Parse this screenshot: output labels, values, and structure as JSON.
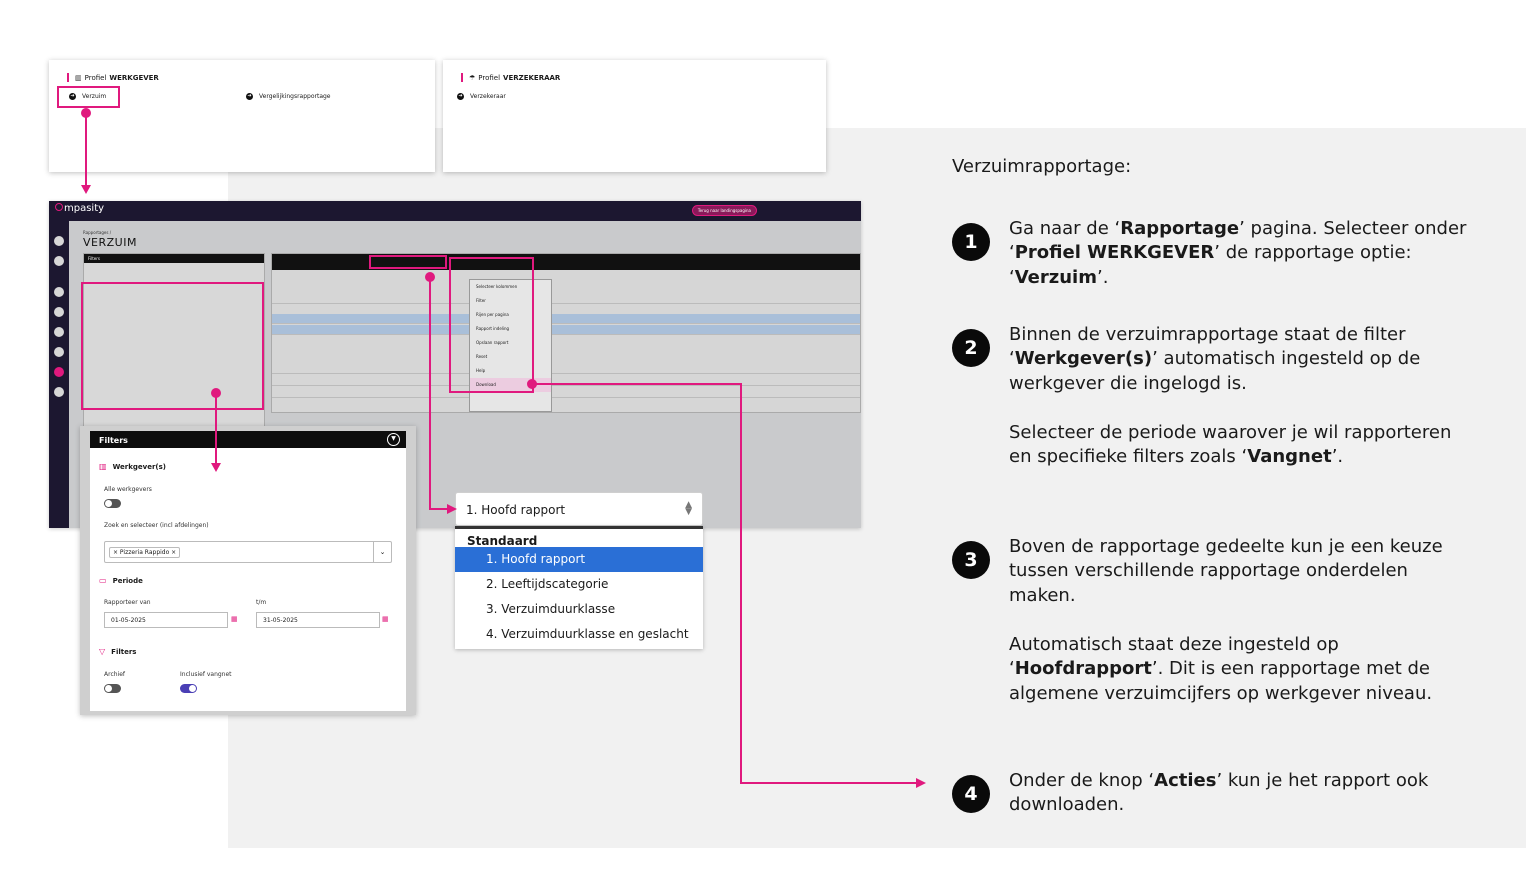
{
  "profile_werkgever": {
    "prefix": "Profiel",
    "name": "WERKGEVER",
    "items": [
      "Verzuim",
      "Vergelijkingsrapportage"
    ]
  },
  "profile_verzekeraar": {
    "prefix": "Profiel",
    "name": "VERZEKERAAR",
    "items": [
      "Verzekeraar"
    ]
  },
  "app": {
    "logo": "mpasity",
    "back_button": "Terug naar landingspagina",
    "breadcrumb": "Rapportages /",
    "title": "VERZUIM",
    "mini_filters_header": "Filters",
    "mini_dropdown_items": [
      "Selecteer kolommen",
      "Filter",
      "Rijen per pagina",
      "Rapport indeling",
      "Opslaan rapport",
      "Reset",
      "Help",
      "Download"
    ]
  },
  "filters": {
    "header": "Filters",
    "werkgevers_title": "Werkgever(s)",
    "alle_werkgevers": "Alle werkgevers",
    "zoek_label": "Zoek en selecteer (incl afdelingen)",
    "selected_tag": "× Pizzeria Rappido ×",
    "periode_title": "Periode",
    "rapporteer_van_label": "Rapporteer van",
    "rapporteer_van_value": "01-05-2025",
    "tm_label": "t/m",
    "tm_value": "31-05-2025",
    "filters_title": "Filters",
    "archief": "Archief",
    "inclusief_vangnet": "Inclusief vangnet",
    "toggles": {
      "alle_werkgevers": false,
      "archief": false,
      "inclusief_vangnet": true
    }
  },
  "rapport_select": {
    "value": "1. Hoofd rapport",
    "group": "Standaard",
    "options": [
      "1. Hoofd rapport",
      "2. Leeftijdscategorie",
      "3. Verzuimduurklasse",
      "4. Verzuimduurklasse en geslacht"
    ],
    "selected_index": 0
  },
  "instructions": {
    "intro": "Verzuimrapportage:",
    "steps": [
      {
        "num": "1",
        "paragraphs": [
          "Ga naar de ‘Rapportage’ pagina. Selecteer onder ‘Profiel WERKGEVER’ de rapportage optie: ‘Verzuim’."
        ]
      },
      {
        "num": "2",
        "paragraphs": [
          "Binnen de verzuimrapportage staat de filter ‘Werkgever(s)’ automatisch ingesteld op de werkgever die ingelogd is.",
          "Selecteer de periode waarover je wil rapporteren en specifieke filters zoals ‘Vangnet’."
        ]
      },
      {
        "num": "3",
        "paragraphs": [
          "Boven de rapportage gedeelte kun je een keuze tussen verschillende rapportage onderdelen maken.",
          "Automatisch staat deze ingesteld op ‘Hoofdrapport’. Dit is een rapportage met de algemene verzuimcijfers op werkgever niveau."
        ]
      },
      {
        "num": "4",
        "paragraphs": [
          "Onder de knop ‘Acties’ kun je het rapport ook downloaden."
        ]
      }
    ]
  },
  "colors": {
    "accent": "#e0197e",
    "highlight": "#2a6fd6",
    "panel": "#f1f1f1"
  }
}
